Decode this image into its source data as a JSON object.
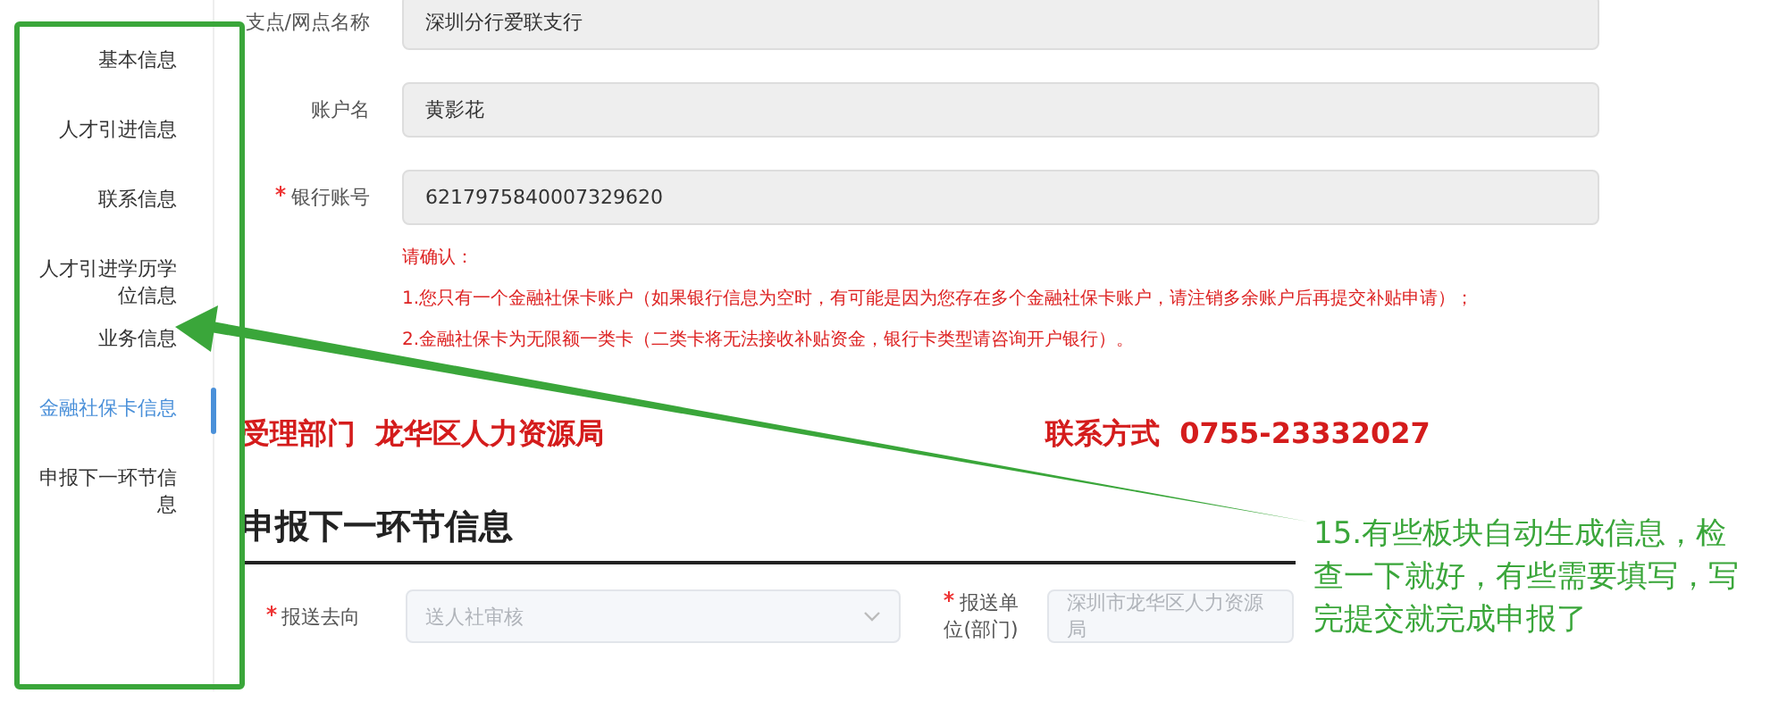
{
  "sidebar": {
    "items": [
      {
        "label": "基本信息",
        "selected": false
      },
      {
        "label": "人才引进信息",
        "selected": false
      },
      {
        "label": "联系信息",
        "selected": false
      },
      {
        "label": "人才引进学历学位信息",
        "selected": false
      },
      {
        "label": "业务信息",
        "selected": false
      },
      {
        "label": "金融社保卡信息",
        "selected": true
      },
      {
        "label": "申报下一环节信息",
        "selected": false
      }
    ]
  },
  "fields": [
    {
      "label": "支点/网点名称",
      "value": "深圳分行爱联支行",
      "required": false
    },
    {
      "label": "账户名",
      "value": "黄影花",
      "required": false
    },
    {
      "label": "银行账号",
      "value": "6217975840007329620",
      "required": true
    }
  ],
  "notice": {
    "title": "请确认：",
    "lines": [
      "1.您只有一个金融社保卡账户（如果银行信息为空时，有可能是因为您存在多个金融社保卡账户，请注销多余账户后再提交补贴申请）；",
      "2.金融社保卡为无限额一类卡（二类卡将无法接收补贴资金，银行卡类型请咨询开户银行）。"
    ]
  },
  "contacts": [
    {
      "text": "受理部门  龙华区人力资源局"
    },
    {
      "text": "联系方式  0755-23332027"
    }
  ],
  "section_heading": "申报下一环节信息",
  "next_step": [
    {
      "kind": "select",
      "label": "报送去向",
      "value": "送人社审核",
      "required": true,
      "disabled": true
    },
    {
      "kind": "input",
      "label": "报送单位(部门)",
      "value": "深圳市龙华区人力资源局",
      "required": true,
      "disabled": true
    }
  ],
  "annotation": "15.有些板块自动生成信息，检查一下就好，有些需要填写，写完提交就完成申报了"
}
